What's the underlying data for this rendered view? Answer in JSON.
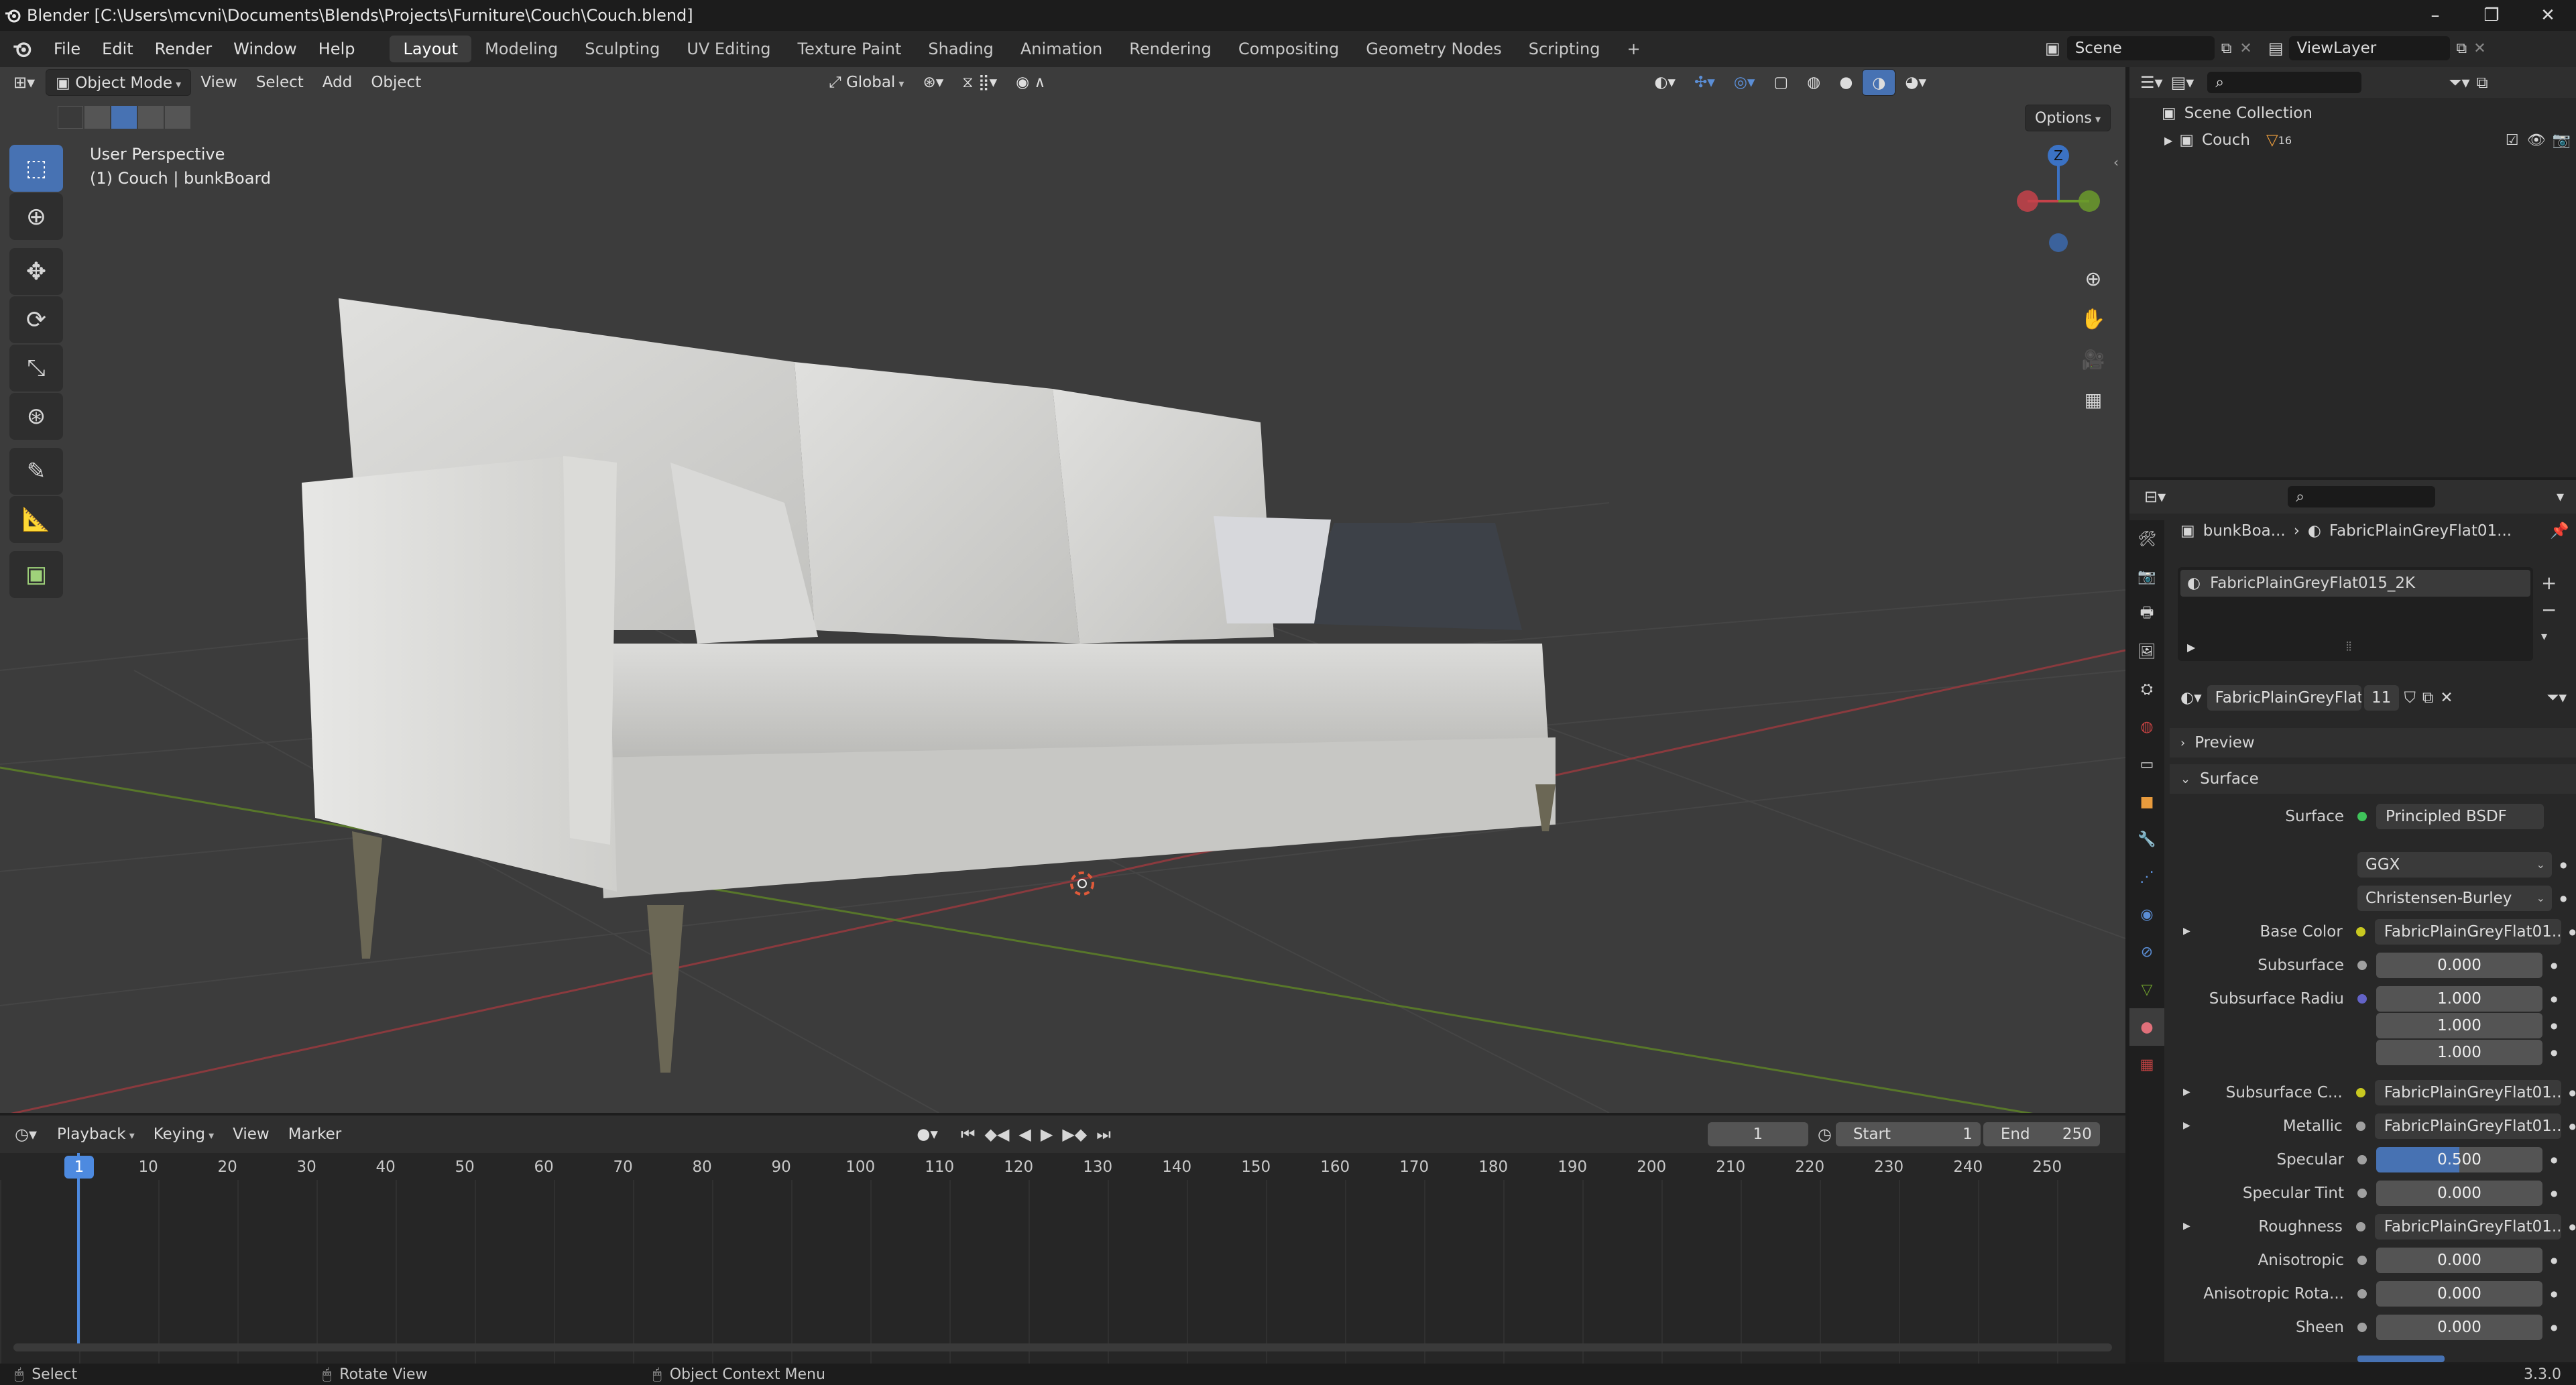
{
  "window": {
    "title": "Blender [C:\\Users\\mcvni\\Documents\\Blends\\Projects\\Furniture\\Couch\\Couch.blend]",
    "controls": [
      "–",
      "❐",
      "✕"
    ]
  },
  "menubar": {
    "menus": [
      "File",
      "Edit",
      "Render",
      "Window",
      "Help"
    ],
    "workspaces": [
      "Layout",
      "Modeling",
      "Sculpting",
      "UV Editing",
      "Texture Paint",
      "Shading",
      "Animation",
      "Rendering",
      "Compositing",
      "Geometry Nodes",
      "Scripting"
    ],
    "active_workspace": "Layout",
    "add_tab": "+",
    "scene": "Scene",
    "view_layer": "ViewLayer"
  },
  "viewport": {
    "mode": "Object Mode",
    "menus": [
      "View",
      "Select",
      "Add",
      "Object"
    ],
    "transform_orientation": "Global",
    "options_label": "Options",
    "perspective_label": "User Perspective",
    "object_label": "(1) Couch | bunkBoard",
    "gizmo_axes": [
      "Z",
      "X",
      "Y"
    ]
  },
  "timeline": {
    "menus": [
      "Playback",
      "Keying",
      "View",
      "Marker"
    ],
    "current_frame": "1",
    "start_label": "Start",
    "start": "1",
    "end_label": "End",
    "end": "250",
    "ruler": [
      "1",
      "10",
      "20",
      "30",
      "40",
      "50",
      "60",
      "70",
      "80",
      "90",
      "100",
      "110",
      "120",
      "130",
      "140",
      "150",
      "160",
      "170",
      "180",
      "190",
      "200",
      "210",
      "220",
      "230",
      "240",
      "250"
    ]
  },
  "status": {
    "select": "Select",
    "rotate": "Rotate View",
    "context": "Object Context Menu",
    "version": "3.3.0"
  },
  "outliner": {
    "root": "Scene Collection",
    "items": [
      {
        "label": "Couch",
        "count": "16"
      }
    ]
  },
  "properties": {
    "breadcrumb_object": "bunkBoa...",
    "breadcrumb_material": "FabricPlainGreyFlat01...",
    "slot": "FabricPlainGreyFlat015_2K",
    "material_name": "FabricPlainGreyFlat...",
    "users": "11",
    "panels": {
      "preview": "Preview",
      "surface": "Surface"
    },
    "surface_label": "Surface",
    "surface_shader": "Principled BSDF",
    "distribution": "GGX",
    "subsurface_method": "Christensen-Burley",
    "rows": [
      {
        "label": "Base Color",
        "kind": "link",
        "value": "FabricPlainGreyFlat01...",
        "dot": "#c8c820",
        "expand": true
      },
      {
        "label": "Subsurface",
        "kind": "num",
        "value": "0.000",
        "dot": "#a0a0a0",
        "expand": false
      },
      {
        "label": "Subsurface Radiu",
        "kind": "num",
        "value": "1.000",
        "dot": "#6363c7",
        "expand": false
      },
      {
        "label": "",
        "kind": "num",
        "value": "1.000",
        "dot": "",
        "expand": false
      },
      {
        "label": "",
        "kind": "num",
        "value": "1.000",
        "dot": "",
        "expand": false
      },
      {
        "label": "Subsurface C...",
        "kind": "link",
        "value": "FabricPlainGreyFlat01...",
        "dot": "#c8c820",
        "expand": true
      },
      {
        "label": "Metallic",
        "kind": "link",
        "value": "FabricPlainGreyFlat01...",
        "dot": "#a0a0a0",
        "expand": true
      },
      {
        "label": "Specular",
        "kind": "num",
        "value": "0.500",
        "dot": "#a0a0a0",
        "expand": false,
        "fill": 0.5
      },
      {
        "label": "Specular Tint",
        "kind": "num",
        "value": "0.000",
        "dot": "#a0a0a0",
        "expand": false
      },
      {
        "label": "Roughness",
        "kind": "link",
        "value": "FabricPlainGreyFlat01...",
        "dot": "#a0a0a0",
        "expand": true
      },
      {
        "label": "Anisotropic",
        "kind": "num",
        "value": "0.000",
        "dot": "#a0a0a0",
        "expand": false
      },
      {
        "label": "Anisotropic Rota...",
        "kind": "num",
        "value": "0.000",
        "dot": "#a0a0a0",
        "expand": false
      },
      {
        "label": "Sheen",
        "kind": "num",
        "value": "0.000",
        "dot": "#a0a0a0",
        "expand": false
      }
    ]
  },
  "colors": {
    "accent": "#4772b3",
    "x_axis": "#c6424a",
    "y_axis": "#6b9a2c",
    "z_axis": "#3b72c4",
    "playhead": "#4d8ae0"
  }
}
